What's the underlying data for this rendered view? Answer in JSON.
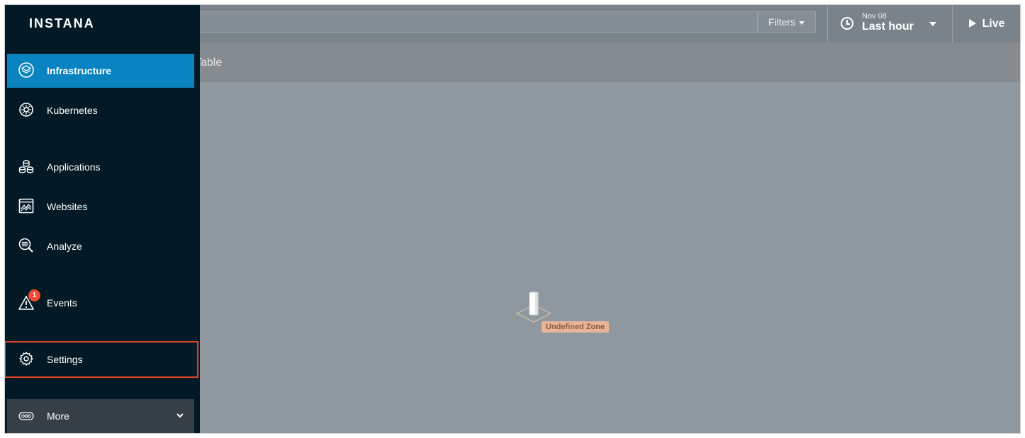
{
  "app": {
    "logo": "INSTANA"
  },
  "header": {
    "filters_label": "Filters",
    "time_date": "Nov 08",
    "time_range": "Last hour",
    "live_label": "Live"
  },
  "subbar": {
    "view_label": "Table"
  },
  "map": {
    "zone_label": "Undefined Zone"
  },
  "sidebar": {
    "items": [
      {
        "label": "Infrastructure",
        "icon": "layers-icon",
        "active": true
      },
      {
        "label": "Kubernetes",
        "icon": "kubernetes-icon"
      },
      {
        "label": "Applications",
        "icon": "applications-icon"
      },
      {
        "label": "Websites",
        "icon": "websites-icon"
      },
      {
        "label": "Analyze",
        "icon": "analyze-icon"
      },
      {
        "label": "Events",
        "icon": "warning-icon",
        "badge": "1"
      },
      {
        "label": "Settings",
        "icon": "gear-icon",
        "highlighted": true
      }
    ],
    "more_label": "More"
  },
  "colors": {
    "sidebar_bg": "#031a26",
    "active_item": "#0a84c1",
    "highlight_border": "#e2442c",
    "badge": "#f04a30",
    "zone_label_bg": "#e8b49a"
  }
}
